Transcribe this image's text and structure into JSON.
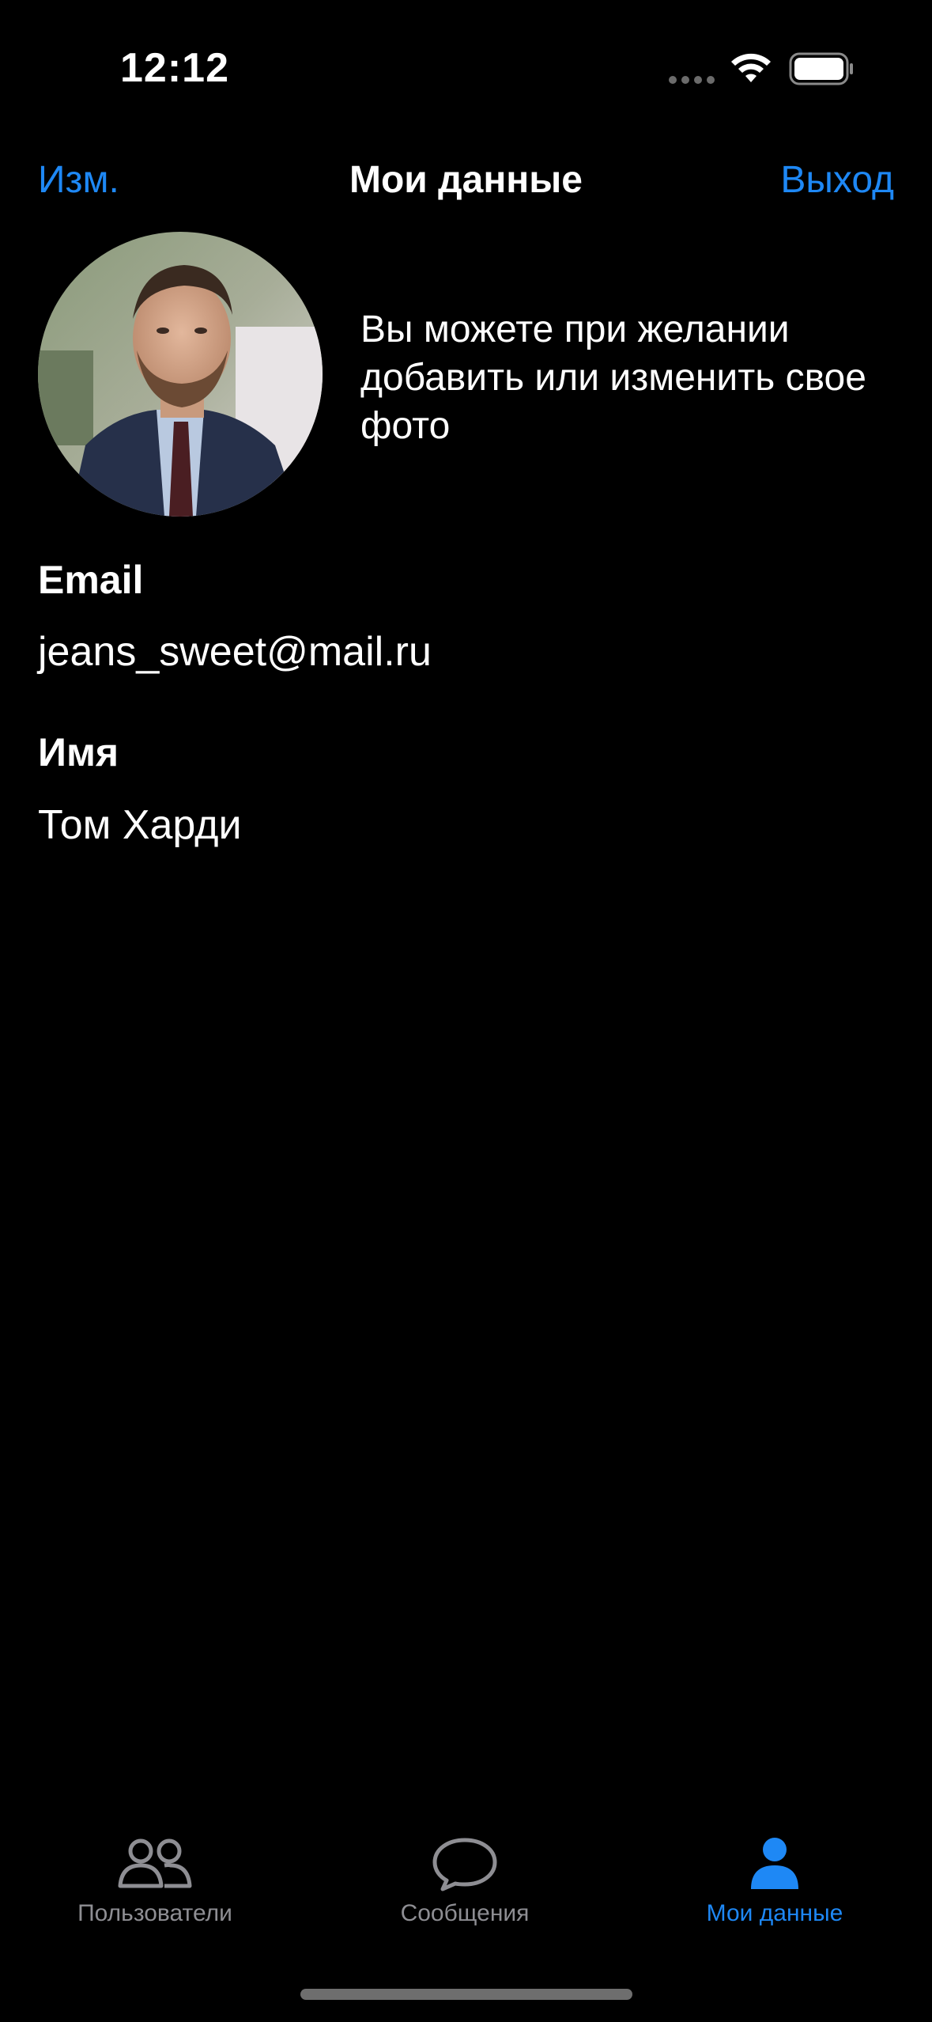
{
  "status_bar": {
    "time": "12:12",
    "icons": [
      "signal-dots-icon",
      "wifi-icon",
      "battery-icon"
    ]
  },
  "nav": {
    "edit_label": "Изм.",
    "title": "Мои данные",
    "logout_label": "Выход"
  },
  "profile": {
    "photo_hint": "Вы можете при желании добавить или изменить свое фото",
    "email_label": "Email",
    "email_value": "jeans_sweet@mail.ru",
    "name_label": "Имя",
    "name_value": "Том Харди"
  },
  "tab_bar": {
    "items": [
      {
        "label": "Пользователи",
        "icon": "users-icon",
        "active": false
      },
      {
        "label": "Сообщения",
        "icon": "message-bubble-icon",
        "active": false
      },
      {
        "label": "Мои данные",
        "icon": "person-icon",
        "active": true
      }
    ]
  },
  "colors": {
    "background": "#000000",
    "accent": "#1e88f5",
    "inactive_tab": "#8e8e93",
    "text": "#ffffff"
  }
}
